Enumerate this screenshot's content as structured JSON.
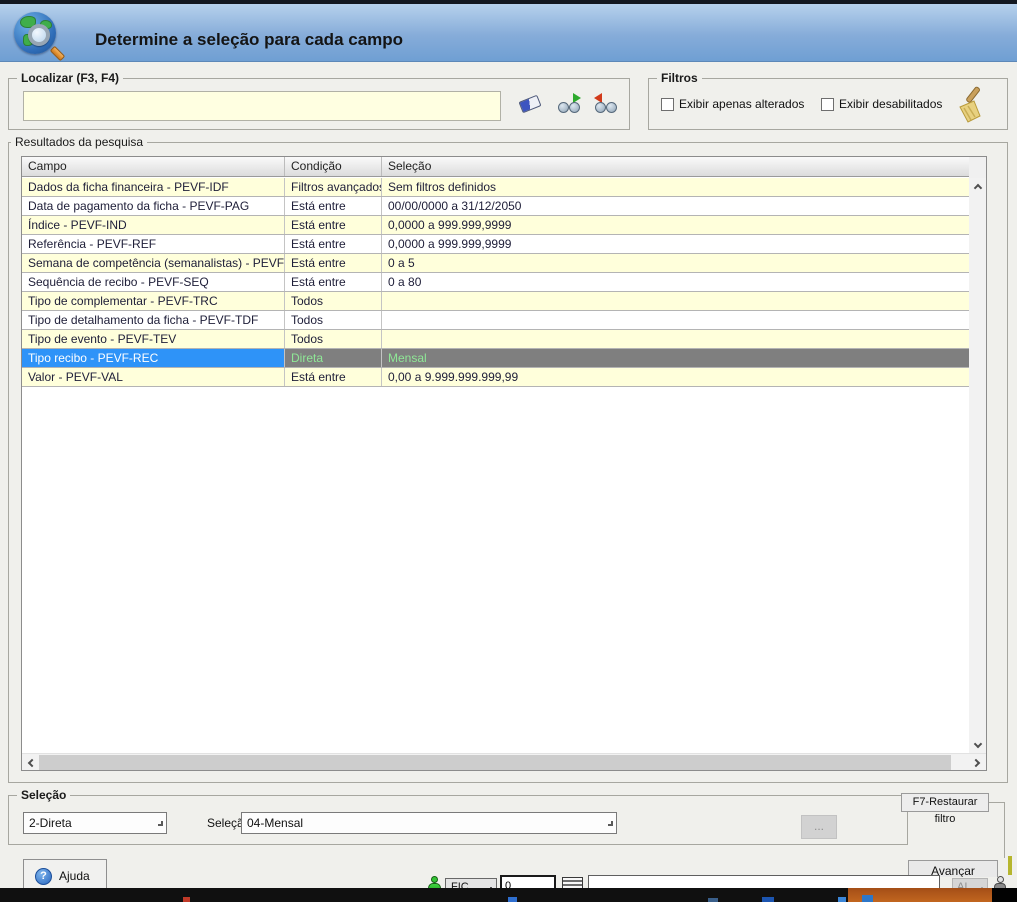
{
  "header": {
    "title": "Determine a seleção para cada campo"
  },
  "localizar": {
    "label": "Localizar (F3, F4)",
    "input_value": "",
    "clear_icon": "eraser-icon",
    "search_next_icon": "binoculars-forward-icon",
    "search_prev_icon": "binoculars-back-icon"
  },
  "filtros": {
    "label": "Filtros",
    "checkboxes": [
      {
        "label": "Exibir apenas alterados",
        "checked": false
      },
      {
        "label": "Exibir desabilitados",
        "checked": false
      }
    ],
    "broom_icon": "broom-icon"
  },
  "results": {
    "label": "Resultados da pesquisa",
    "columns": [
      "Campo",
      "Condição",
      "Seleção"
    ],
    "rows": [
      {
        "campo": "Dados da ficha financeira - PEVF-IDF",
        "condicao": "Filtros avançados",
        "selecao": "Sem filtros definidos",
        "selected": false
      },
      {
        "campo": "Data de pagamento da ficha - PEVF-PAG",
        "condicao": "Está entre",
        "selecao": "00/00/0000 a 31/12/2050",
        "selected": false
      },
      {
        "campo": "Índice - PEVF-IND",
        "condicao": "Está entre",
        "selecao": "0,0000 a 999.999,9999",
        "selected": false
      },
      {
        "campo": "Referência - PEVF-REF",
        "condicao": "Está entre",
        "selecao": "0,0000 a 999.999,9999",
        "selected": false
      },
      {
        "campo": "Semana de competência (semanalistas) - PEVF-SEM",
        "condicao": "Está entre",
        "selecao": "0 a 5",
        "selected": false
      },
      {
        "campo": "Sequência de recibo - PEVF-SEQ",
        "condicao": "Está entre",
        "selecao": "0 a 80",
        "selected": false
      },
      {
        "campo": "Tipo de complementar - PEVF-TRC",
        "condicao": "Todos",
        "selecao": "",
        "selected": false
      },
      {
        "campo": "Tipo de detalhamento da ficha - PEVF-TDF",
        "condicao": "Todos",
        "selecao": "",
        "selected": false
      },
      {
        "campo": "Tipo de evento - PEVF-TEV",
        "condicao": "Todos",
        "selecao": "",
        "selected": false
      },
      {
        "campo": "Tipo recibo - PEVF-REC",
        "condicao": "Direta",
        "selecao": "Mensal",
        "selected": true
      },
      {
        "campo": "Valor - PEVF-VAL",
        "condicao": "Está entre",
        "selecao": "0,00 a 9.999.999.999,99",
        "selected": false
      }
    ]
  },
  "selecao": {
    "label": "Seleção",
    "condition_value": "2-Direta",
    "selecao_label": "Seleção",
    "selecao_value": "04-Mensal",
    "more_button_label": "...",
    "restore_button_label": "F7-Restaurar filtro"
  },
  "footer": {
    "help_label": "Ajuda",
    "help_icon_glyph": "?",
    "advance_label": "Avançar"
  },
  "statusbar": {
    "fic_label": "FIC",
    "counter_value": "0",
    "text_field_value": "",
    "ai_label": "AI"
  },
  "colors": {
    "selected_row_blue": "#2e93f8",
    "selected_row_gray": "#7f7f7f",
    "selected_row_green_text": "#8fe896",
    "row_yellow": "#ffffdb",
    "header_gradient_top": "#b6d1ec",
    "header_gradient_bottom": "#6f9fd3",
    "input_yellow": "#ffffe1"
  }
}
